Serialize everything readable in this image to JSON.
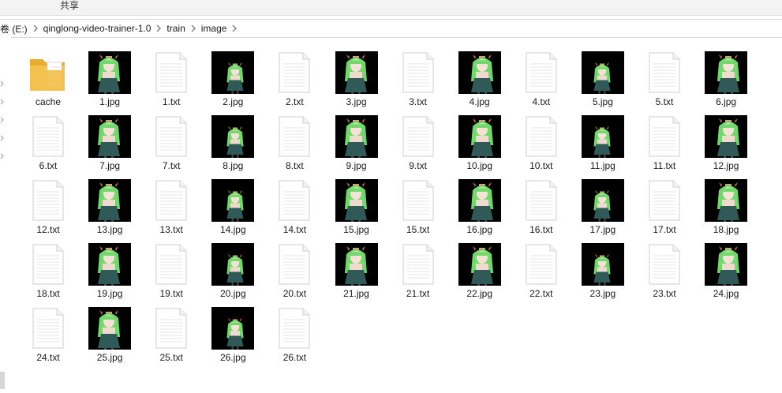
{
  "ribbon": {
    "share_tab": "共享"
  },
  "address": {
    "crumbs": [
      "卷 (E:)",
      "qinglong-video-trainer-1.0",
      "train",
      "image"
    ]
  },
  "colors": {
    "accent_hair": "#6fd96a",
    "dress": "#2f5a58",
    "folder": "#f2c14e",
    "background": "#ffffff"
  },
  "files": [
    {
      "name": "cache",
      "type": "folder"
    },
    {
      "name": "1.jpg",
      "type": "image"
    },
    {
      "name": "1.txt",
      "type": "text"
    },
    {
      "name": "2.jpg",
      "type": "image"
    },
    {
      "name": "2.txt",
      "type": "text"
    },
    {
      "name": "3.jpg",
      "type": "image"
    },
    {
      "name": "3.txt",
      "type": "text"
    },
    {
      "name": "4.jpg",
      "type": "image"
    },
    {
      "name": "4.txt",
      "type": "text"
    },
    {
      "name": "5.jpg",
      "type": "image"
    },
    {
      "name": "5.txt",
      "type": "text"
    },
    {
      "name": "6.jpg",
      "type": "image"
    },
    {
      "name": "6.txt",
      "type": "text"
    },
    {
      "name": "7.jpg",
      "type": "image"
    },
    {
      "name": "7.txt",
      "type": "text"
    },
    {
      "name": "8.jpg",
      "type": "image"
    },
    {
      "name": "8.txt",
      "type": "text"
    },
    {
      "name": "9.jpg",
      "type": "image"
    },
    {
      "name": "9.txt",
      "type": "text"
    },
    {
      "name": "10.jpg",
      "type": "image"
    },
    {
      "name": "10.txt",
      "type": "text"
    },
    {
      "name": "11.jpg",
      "type": "image"
    },
    {
      "name": "11.txt",
      "type": "text"
    },
    {
      "name": "12.jpg",
      "type": "image"
    },
    {
      "name": "12.txt",
      "type": "text"
    },
    {
      "name": "13.jpg",
      "type": "image"
    },
    {
      "name": "13.txt",
      "type": "text"
    },
    {
      "name": "14.jpg",
      "type": "image"
    },
    {
      "name": "14.txt",
      "type": "text"
    },
    {
      "name": "15.jpg",
      "type": "image"
    },
    {
      "name": "15.txt",
      "type": "text"
    },
    {
      "name": "16.jpg",
      "type": "image"
    },
    {
      "name": "16.txt",
      "type": "text"
    },
    {
      "name": "17.jpg",
      "type": "image"
    },
    {
      "name": "17.txt",
      "type": "text"
    },
    {
      "name": "18.jpg",
      "type": "image"
    },
    {
      "name": "18.txt",
      "type": "text"
    },
    {
      "name": "19.jpg",
      "type": "image"
    },
    {
      "name": "19.txt",
      "type": "text"
    },
    {
      "name": "20.jpg",
      "type": "image"
    },
    {
      "name": "20.txt",
      "type": "text"
    },
    {
      "name": "21.jpg",
      "type": "image"
    },
    {
      "name": "21.txt",
      "type": "text"
    },
    {
      "name": "22.jpg",
      "type": "image"
    },
    {
      "name": "22.txt",
      "type": "text"
    },
    {
      "name": "23.jpg",
      "type": "image"
    },
    {
      "name": "23.txt",
      "type": "text"
    },
    {
      "name": "24.jpg",
      "type": "image"
    },
    {
      "name": "24.txt",
      "type": "text"
    },
    {
      "name": "25.jpg",
      "type": "image"
    },
    {
      "name": "25.txt",
      "type": "text"
    },
    {
      "name": "26.jpg",
      "type": "image"
    },
    {
      "name": "26.txt",
      "type": "text"
    }
  ]
}
